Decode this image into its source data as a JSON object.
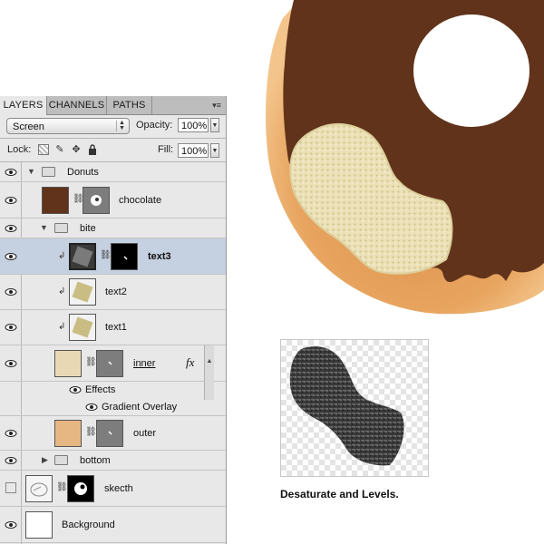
{
  "layers_panel": {
    "tabs": [
      {
        "label": "LAYERS",
        "active": true
      },
      {
        "label": "CHANNELS",
        "active": false
      },
      {
        "label": "PATHS",
        "active": false
      }
    ],
    "blend_mode": "Screen",
    "opacity_label": "Opacity:",
    "opacity_value": "100%",
    "lock_label": "Lock:",
    "fill_label": "Fill:",
    "fill_value": "100%",
    "layers": {
      "donuts": "Donuts",
      "chocolate": "chocolate",
      "bite": "bite",
      "text3": "text3",
      "text2": "text2",
      "text1": "text1",
      "inner": "inner",
      "effects": "Effects",
      "gradient_overlay": "Gradient Overlay",
      "outer": "outer",
      "bottom": "bottom",
      "skecth": "skecth",
      "background": "Background"
    },
    "fx_label": "fx"
  },
  "caption": "Desaturate and Levels.",
  "colors": {
    "chocolate": "#61331a",
    "dough": "#e8a560",
    "inner_swatch": "#e8d8b4",
    "outer_swatch": "#e7b783",
    "selection": "#c5d0e0",
    "texture": "#c9bd84"
  }
}
